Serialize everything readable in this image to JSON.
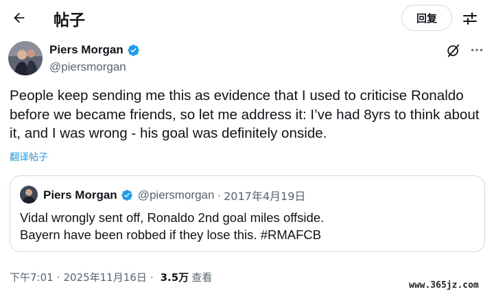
{
  "header": {
    "title": "帖子",
    "reply_label": "回复"
  },
  "tweet": {
    "author_name": "Piers Morgan",
    "author_handle": "@piersmorgan",
    "text": "People keep sending me this as evidence that I used to criticise Ronaldo before we became friends, so let me address it: I’ve had 8yrs to think about it, and I was wrong - his goal was definitely onside.",
    "translate_label": "翻译帖子"
  },
  "quote": {
    "author_name": "Piers Morgan",
    "author_handle": "@piersmorgan",
    "separator": "·",
    "date": "2017年4月19日",
    "text_line1": "Vidal wrongly sent off, Ronaldo 2nd goal miles offside.",
    "text_line2": "Bayern have been robbed if they lose this. #RMAFCB"
  },
  "meta": {
    "time": "下午7:01",
    "separator": "·",
    "date": "2025年11月16日",
    "views_count": "3.5万",
    "views_label": "查看"
  },
  "watermark": "www.365jz.com",
  "colors": {
    "text": "#0f1419",
    "secondary": "#536471",
    "link": "#1d9bf0",
    "border": "#cfd9de",
    "verified": "#1d9bf0"
  },
  "icons": [
    "back-arrow-icon",
    "filter-icon",
    "verified-badge-icon",
    "grok-icon",
    "more-icon"
  ]
}
